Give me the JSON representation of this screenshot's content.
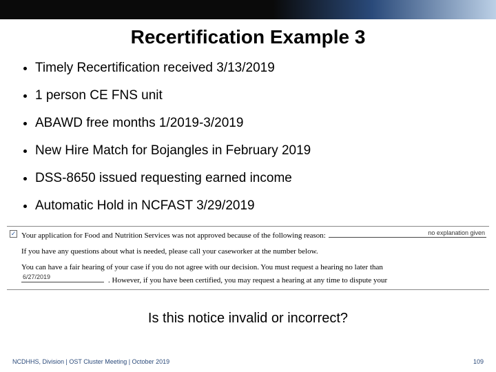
{
  "title": "Recertification Example 3",
  "bullets": [
    "Timely Recertification received 3/13/2019",
    "1 person CE FNS unit",
    "ABAWD free months 1/2019-3/2019",
    "New Hire Match for Bojangles in February 2019",
    "DSS-8650 issued requesting earned income",
    "Automatic Hold in NCFAST 3/29/2019"
  ],
  "notice": {
    "checkbox_glyph": "✓",
    "line1": "Your application for Food and Nutrition Services was not approved because of the following reason:",
    "reason": "no explanation given",
    "line2": "If you have any questions about what is needed, please call your caseworker at the number below.",
    "line3a": "You can have a fair hearing of your case if you do not agree with our decision.  You must request a hearing no later than",
    "date": "6/27/2019",
    "line3b": ".  However, if you have been certified, you may request a hearing at any time to dispute your"
  },
  "question": "Is this notice invalid or incorrect?",
  "footer": {
    "left": "NCDHHS, Division | OST Cluster Meeting | October 2019",
    "right": "109"
  }
}
